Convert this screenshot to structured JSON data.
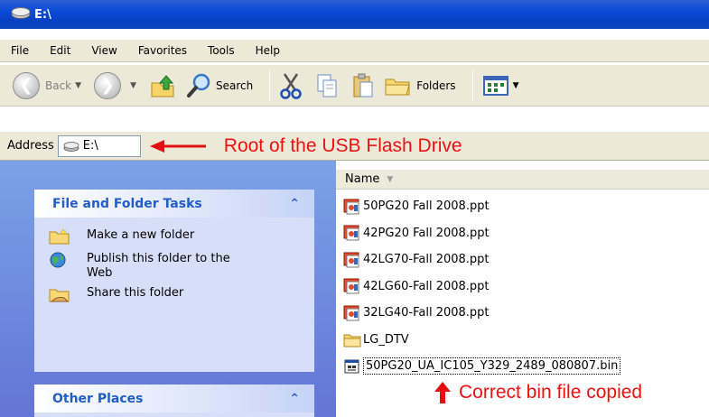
{
  "window": {
    "title": "E:\\",
    "title_icon": "drive-icon"
  },
  "menu": [
    "File",
    "Edit",
    "View",
    "Favorites",
    "Tools",
    "Help"
  ],
  "toolbar": {
    "back_label": "Back",
    "search_label": "Search",
    "folders_label": "Folders"
  },
  "address": {
    "label": "Address",
    "value": "E:\\",
    "annotation": "Root of the USB Flash Drive"
  },
  "tasks_panel": {
    "title": "File and Folder Tasks",
    "items": [
      {
        "label": "Make a new folder",
        "icon": "new-folder-icon"
      },
      {
        "label": "Publish this folder to the Web",
        "icon": "globe-icon"
      },
      {
        "label": "Share this folder",
        "icon": "share-folder-icon"
      }
    ]
  },
  "other_panel": {
    "title": "Other Places"
  },
  "files": {
    "column": "Name",
    "items": [
      {
        "name": "50PG20 Fall 2008.ppt",
        "icon": "ppt-icon"
      },
      {
        "name": "42PG20 Fall 2008.ppt",
        "icon": "ppt-icon"
      },
      {
        "name": "42LG70-Fall 2008.ppt",
        "icon": "ppt-icon"
      },
      {
        "name": "42LG60-Fall 2008.ppt",
        "icon": "ppt-icon"
      },
      {
        "name": "32LG40-Fall 2008.ppt",
        "icon": "ppt-icon"
      },
      {
        "name": "LG_DTV",
        "icon": "folder-icon"
      },
      {
        "name": "50PG20_UA_IC105_Y329_2489_080807.bin",
        "icon": "bin-file-icon"
      }
    ],
    "annotation": "Correct bin file copied"
  },
  "colors": {
    "annotation": "#e11111",
    "title_bar": "#0a49d8",
    "panel_title": "#215dc6"
  }
}
